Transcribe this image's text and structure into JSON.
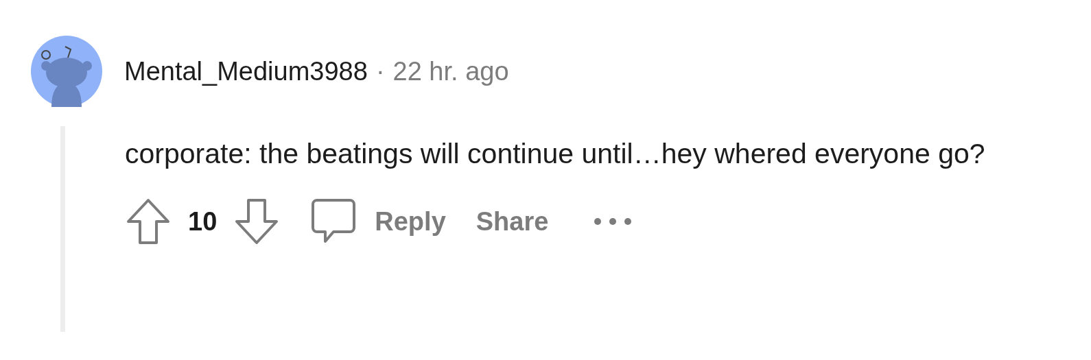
{
  "comment": {
    "author": "Mental_Medium3988",
    "separator": "·",
    "time": "22 hr. ago",
    "body": "corporate: the beatings will continue until…hey whered everyone go?",
    "score": "10",
    "actions": [
      {
        "kind": "reply",
        "label": "Reply"
      },
      {
        "kind": "share",
        "label": "Share"
      }
    ]
  }
}
